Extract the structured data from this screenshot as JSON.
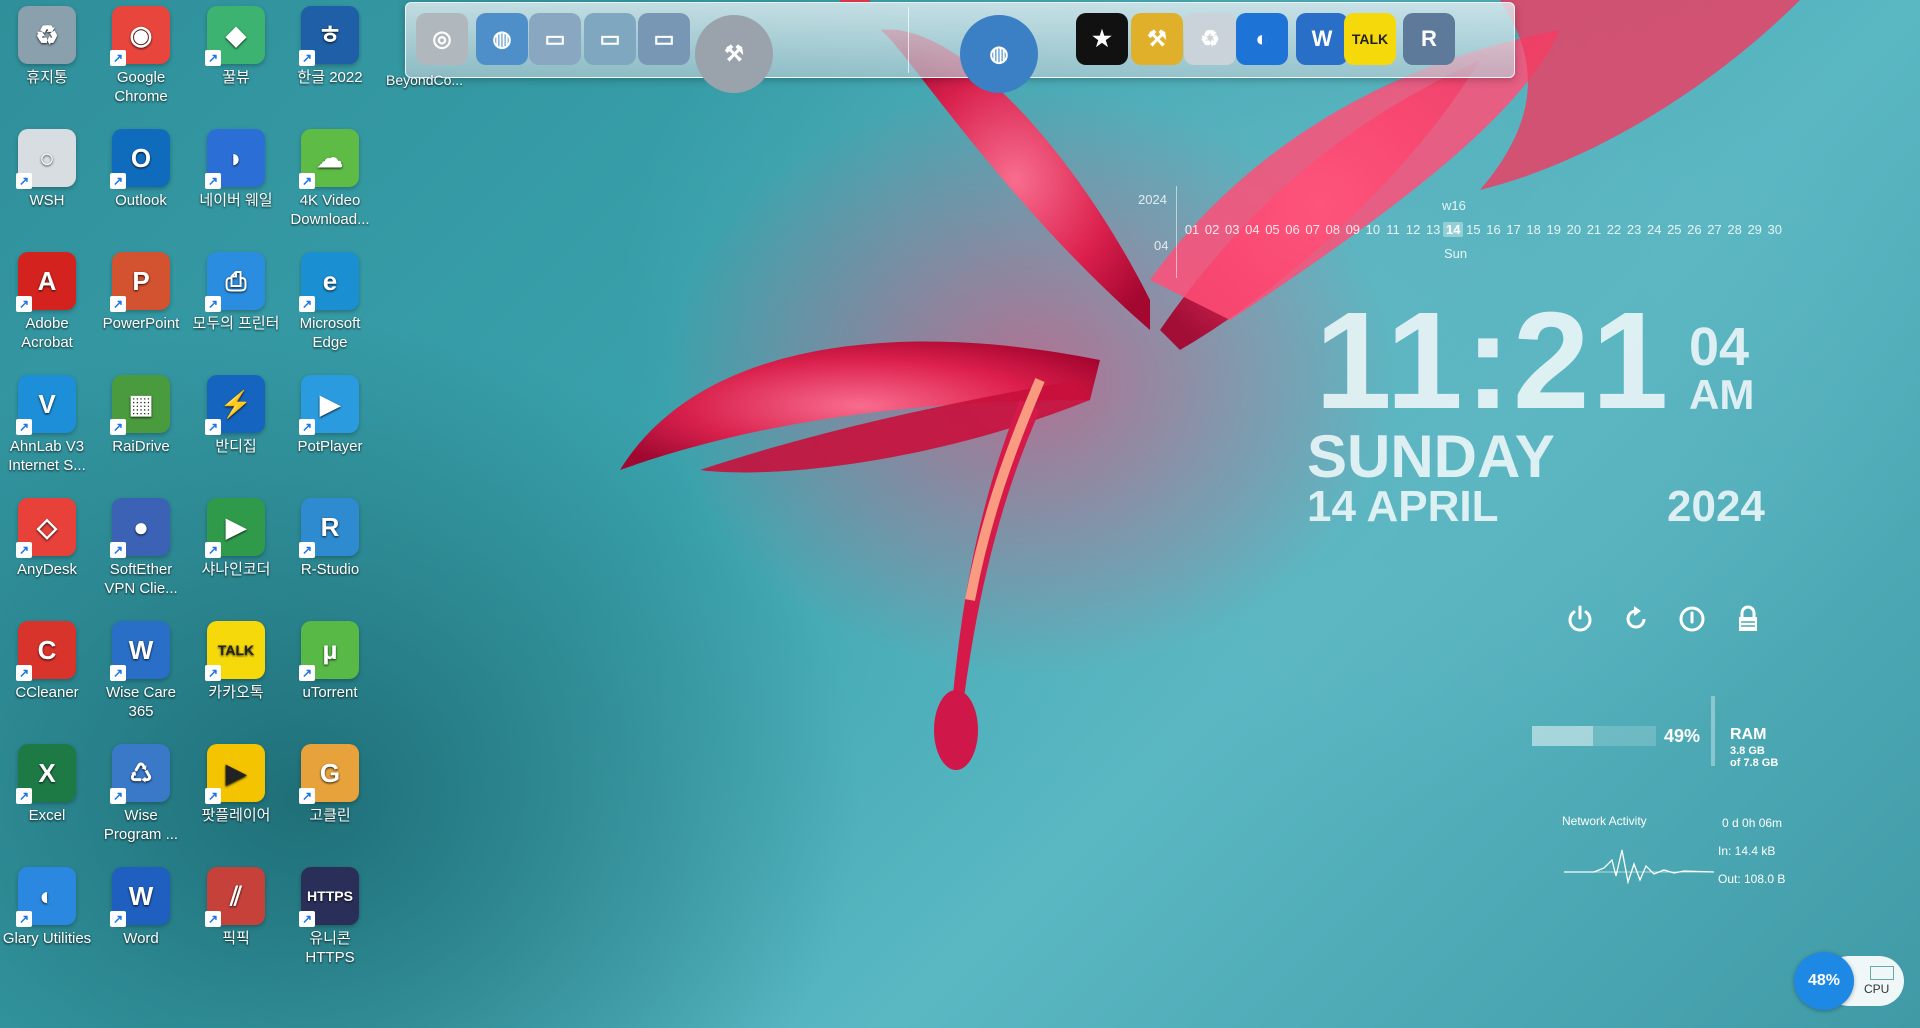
{
  "desktop": {
    "icons": [
      {
        "label": "휴지통",
        "color": "#8aa0ad",
        "glyph": "♻"
      },
      {
        "label": "Google Chrome",
        "color": "#e8453c",
        "glyph": "◉"
      },
      {
        "label": "꿀뷰",
        "color": "#3cb371",
        "glyph": "◆"
      },
      {
        "label": "한글 2022",
        "color": "#1e5fa8",
        "glyph": "ㅎ"
      },
      {
        "label": "WSH",
        "color": "#d8dde2",
        "glyph": "○"
      },
      {
        "label": "Outlook",
        "color": "#0f6cbd",
        "glyph": "O"
      },
      {
        "label": "네이버 웨일",
        "color": "#2b6fd6",
        "glyph": "◗"
      },
      {
        "label": "4K Video Download...",
        "color": "#5dbb46",
        "glyph": "☁"
      },
      {
        "label": "Adobe Acrobat",
        "color": "#d4231e",
        "glyph": "A"
      },
      {
        "label": "PowerPoint",
        "color": "#d35230",
        "glyph": "P"
      },
      {
        "label": "모두의 프린터",
        "color": "#2a8de0",
        "glyph": "⎙"
      },
      {
        "label": "Microsoft Edge",
        "color": "#1a8fd1",
        "glyph": "e"
      },
      {
        "label": "AhnLab V3 Internet S...",
        "color": "#1d8ed8",
        "glyph": "V"
      },
      {
        "label": "RaiDrive",
        "color": "#4a9a3e",
        "glyph": "▦"
      },
      {
        "label": "반디집",
        "color": "#1565c0",
        "glyph": "⚡"
      },
      {
        "label": "PotPlayer",
        "color": "#2b9be0",
        "glyph": "▶"
      },
      {
        "label": "AnyDesk",
        "color": "#e8413a",
        "glyph": "◇"
      },
      {
        "label": "SoftEther VPN Clie...",
        "color": "#3b62b5",
        "glyph": "●"
      },
      {
        "label": "샤나인코더",
        "color": "#2f9a4a",
        "glyph": "▶"
      },
      {
        "label": "R-Studio",
        "color": "#2e8bcf",
        "glyph": "R"
      },
      {
        "label": "CCleaner",
        "color": "#d9342b",
        "glyph": "C"
      },
      {
        "label": "Wise Care 365",
        "color": "#2a6fc7",
        "glyph": "W"
      },
      {
        "label": "카카오톡",
        "color": "#f5d90a",
        "glyph": "TALK"
      },
      {
        "label": "uTorrent",
        "color": "#58b947",
        "glyph": "µ"
      },
      {
        "label": "Excel",
        "color": "#1d7a45",
        "glyph": "X"
      },
      {
        "label": "Wise Program ...",
        "color": "#3a78c8",
        "glyph": "♺"
      },
      {
        "label": "팟플레이어",
        "color": "#f4c400",
        "glyph": "▶"
      },
      {
        "label": "고클린",
        "color": "#e8a23b",
        "glyph": "G"
      },
      {
        "label": "Glary Utilities",
        "color": "#2a88e0",
        "glyph": "◐"
      },
      {
        "label": "Word",
        "color": "#1f5fbf",
        "glyph": "W"
      },
      {
        "label": "픽픽",
        "color": "#c6413a",
        "glyph": "⫽"
      },
      {
        "label": "유니콘 HTTPS",
        "color": "#2a2f5a",
        "glyph": "HTTPS"
      }
    ]
  },
  "dock": {
    "label": "BeyondCo...",
    "items": [
      {
        "name": "beyond-compare",
        "color": "#b0b7bd",
        "glyph": "◎"
      },
      {
        "name": "network-globe",
        "color": "#4f8fc9",
        "glyph": "◍"
      },
      {
        "name": "folder",
        "color": "#8aa7c2",
        "glyph": "▭"
      },
      {
        "name": "folder-tools",
        "color": "#7fa7c0",
        "glyph": "▭"
      },
      {
        "name": "folder-images",
        "color": "#7797b5",
        "glyph": "▭"
      },
      {
        "name": "developer-tools",
        "color": "#9aa3ab",
        "glyph": "⚒"
      },
      {
        "name": "globe-browser",
        "color": "#3b7fc4",
        "glyph": "◍"
      },
      {
        "name": "tshirt",
        "color": "#111111",
        "glyph": "★"
      },
      {
        "name": "hammer",
        "color": "#e0b02a",
        "glyph": "⚒"
      },
      {
        "name": "recycle-bin",
        "color": "#c9d3d9",
        "glyph": "♻"
      },
      {
        "name": "glary-utilities",
        "color": "#1e74d6",
        "glyph": "◐"
      },
      {
        "name": "wise-care",
        "color": "#2a6fc7",
        "glyph": "W"
      },
      {
        "name": "kakaotalk",
        "color": "#f5d90a",
        "glyph": "TALK"
      },
      {
        "name": "r-studio",
        "color": "#5e7a9a",
        "glyph": "R"
      }
    ]
  },
  "calendar": {
    "year": "2024",
    "month": "04",
    "week": "w16",
    "weekday": "Sun",
    "today": "14",
    "days": [
      "01",
      "02",
      "03",
      "04",
      "05",
      "06",
      "07",
      "08",
      "09",
      "10",
      "11",
      "12",
      "13",
      "14",
      "15",
      "16",
      "17",
      "18",
      "19",
      "20",
      "21",
      "22",
      "23",
      "24",
      "25",
      "26",
      "27",
      "28",
      "29",
      "30"
    ]
  },
  "clock": {
    "time": "11:21",
    "seconds": "04",
    "ampm": "AM",
    "day": "SUNDAY",
    "date": "14 APRIL",
    "year": "2024"
  },
  "power": {
    "shutdown_icon": "power-icon",
    "restart_icon": "restart-icon",
    "sleep_icon": "sleep-icon",
    "lock_icon": "lock-icon"
  },
  "ram": {
    "percent_label": "49%",
    "percent": 49,
    "label": "RAM",
    "used": "3.8 GB",
    "total": "of 7.8 GB"
  },
  "network": {
    "title": "Network Activity",
    "uptime": "0 d 0h 06m",
    "in": "In: 14.4 kB",
    "out": "Out: 108.0 B"
  },
  "cpu": {
    "percent_label": "48%",
    "label": "CPU"
  }
}
